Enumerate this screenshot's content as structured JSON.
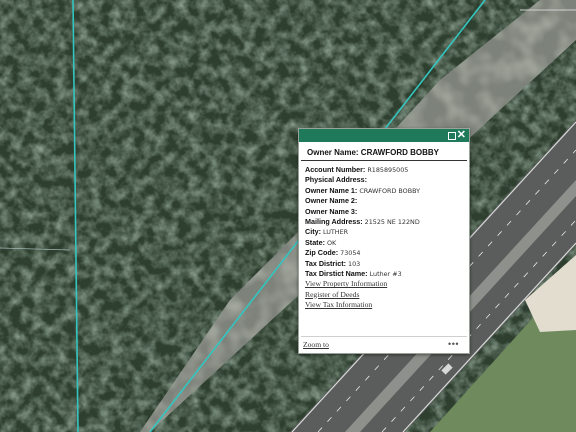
{
  "popup": {
    "header": "Owner Name: CRAWFORD BOBBY",
    "fields": [
      {
        "label": "Account Number:",
        "value": "R185895005"
      },
      {
        "label": "Physical Address:",
        "value": ""
      },
      {
        "label": "Owner Name 1:",
        "value": "CRAWFORD BOBBY"
      },
      {
        "label": "Owner Name 2:",
        "value": ""
      },
      {
        "label": "Owner Name 3:",
        "value": ""
      },
      {
        "label": "Mailing Address:",
        "value": "21525 NE 122ND"
      },
      {
        "label": "City:",
        "value": "LUTHER"
      },
      {
        "label": "State:",
        "value": "OK"
      },
      {
        "label": "Zip Code:",
        "value": "73054"
      },
      {
        "label": "Tax District:",
        "value": "103"
      },
      {
        "label": "Tax Dirstict Name:",
        "value": "Luther #3"
      }
    ],
    "links": [
      "View Property Information",
      "Register of Deeds",
      "View Tax Information"
    ],
    "zoom_label": "Zoom to",
    "more_label": "•••"
  },
  "colors": {
    "popup_titlebar": "#1f7a5c",
    "parcel_line": "#33c6c0",
    "forest": "#2e3f2f",
    "road": "#5a5d5c",
    "lane_marking": "#e8e8e8"
  },
  "icons": {
    "maximize": "square-outline-icon",
    "close": "close-x-icon",
    "more": "ellipsis-icon"
  }
}
